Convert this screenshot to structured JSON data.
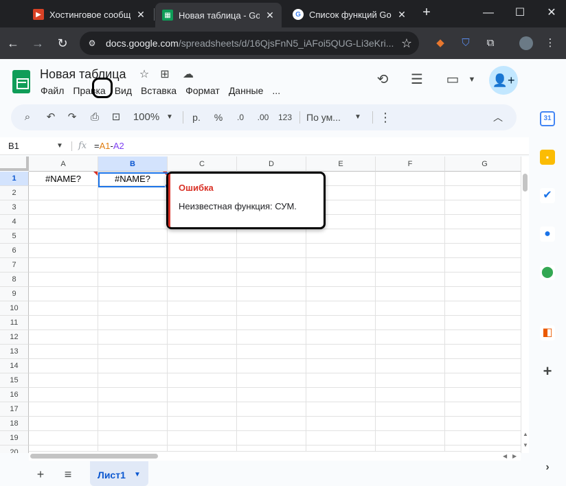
{
  "browser": {
    "tabs": [
      {
        "title": "Хостинговое сообщество",
        "favicon_color": "#d94226",
        "favicon_icon": "play-icon"
      },
      {
        "title": "Новая таблица - Google",
        "favicon_color": "#0f9d58",
        "favicon_icon": "sheets-icon"
      },
      {
        "title": "Список функций Google",
        "favicon_color": "#4285f4",
        "favicon_icon": "google-icon"
      }
    ],
    "tab_close_glyph": "✕",
    "new_tab_glyph": "+",
    "window_controls": {
      "minimize": "—",
      "maximize": "☐",
      "close": "✕"
    },
    "url_host": "docs.google.com",
    "url_rest": "/spreadsheets/d/16QjsFnN5_iAFoi5QUG-Li3eKri...",
    "nav": {
      "back": "←",
      "forward": "→",
      "reload": "↻"
    }
  },
  "doc": {
    "title": "Новая таблица",
    "menu": [
      "Файл",
      "Правка",
      "Вид",
      "Вставка",
      "Формат",
      "Данные",
      "..."
    ]
  },
  "toolbar": {
    "zoom": "100%",
    "currency": "р.",
    "percent": "%",
    "dec_decrease": ".0",
    "dec_increase": ".00",
    "number_format": "123",
    "font": "По ум...",
    "more": "⋮"
  },
  "formula_bar": {
    "namebox": "B1",
    "fx": "fx",
    "formula_eq": "=",
    "formula_ref1": "A1",
    "formula_op": "-",
    "formula_ref2": "A2"
  },
  "grid": {
    "columns": [
      "A",
      "B",
      "C",
      "D",
      "E",
      "F",
      "G"
    ],
    "selected_column": "B",
    "rows": [
      "1",
      "2",
      "3",
      "4",
      "5",
      "6",
      "7",
      "8",
      "9",
      "10",
      "11",
      "12",
      "13",
      "14",
      "15",
      "16",
      "17",
      "18",
      "19",
      "20"
    ],
    "selected_row": "1",
    "cells": {
      "A1": "#NAME?",
      "B1": "#NAME?"
    }
  },
  "error_popup": {
    "title": "Ошибка",
    "message": "Неизвестная функция: СУМ."
  },
  "sheets": {
    "add": "+",
    "list": "≡",
    "active": "Лист1"
  },
  "colors": {
    "accent": "#0b57d0",
    "error": "#d93025",
    "share_button": "#c2e7ff",
    "ref_orange": "#e07c0e",
    "ref_purple": "#7e3ff2"
  }
}
